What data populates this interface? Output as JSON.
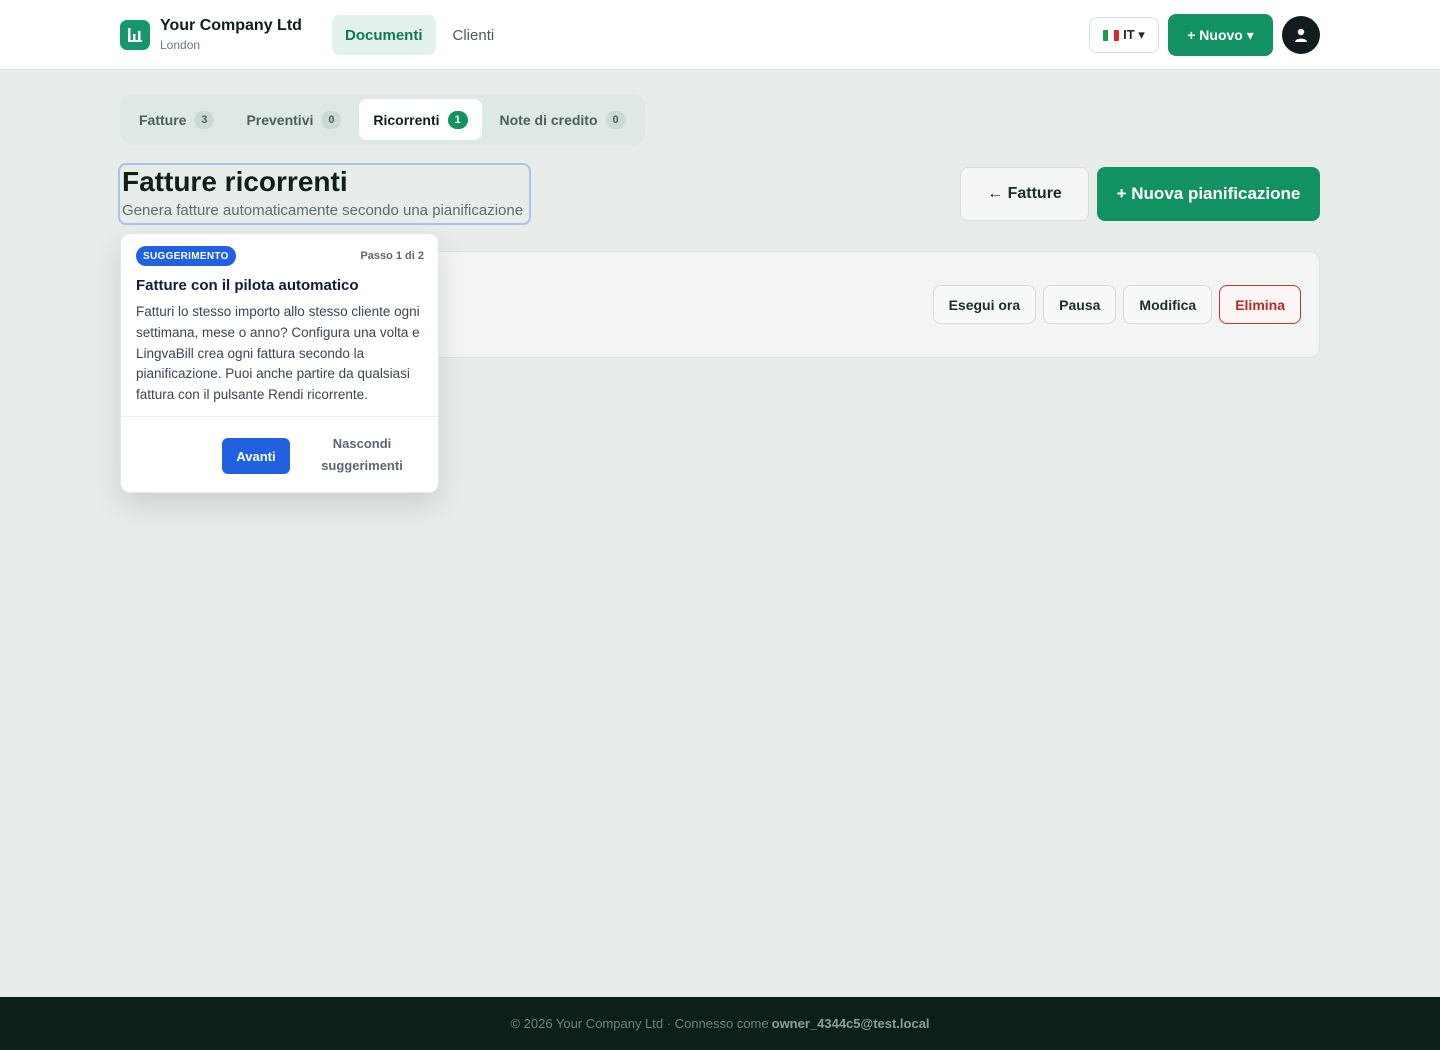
{
  "header": {
    "company_name": "Your Company Ltd",
    "company_city": "London",
    "nav": [
      {
        "label": "Documenti",
        "active": true
      },
      {
        "label": "Clienti",
        "active": false
      }
    ],
    "language": "IT ▾",
    "new_button": "+ Nuovo ▾",
    "brand_color": "#129163"
  },
  "tabs": [
    {
      "label": "Fatture",
      "count": "3",
      "active": false
    },
    {
      "label": "Preventivi",
      "count": "0",
      "active": false
    },
    {
      "label": "Ricorrenti",
      "count": "1",
      "active": true
    },
    {
      "label": "Note di credito",
      "count": "0",
      "active": false
    }
  ],
  "page": {
    "title": "Fatture ricorrenti",
    "subtitle": "Genera fatture automaticamente secondo una pianificazione",
    "back_button": "← Fatture",
    "new_schedule_button": "+ Nuova pianificazione"
  },
  "card": {
    "actions": {
      "run": "Esegui ora",
      "pause": "Pausa",
      "edit": "Modifica",
      "delete": "Elimina"
    }
  },
  "tooltip": {
    "badge": "SUGGERIMENTO",
    "step": "Passo 1 di 2",
    "title": "Fatture con il pilota automatico",
    "body": "Fatturi lo stesso importo allo stesso cliente ogni settimana, mese o anno? Configura una volta e LingvaBill crea ogni fattura secondo la pianificazione. Puoi anche partire da qualsiasi fattura con il pulsante Rendi ricorrente.",
    "next_button": "Avanti",
    "hide_button": "Nascondi suggerimenti",
    "accent_color": "#2160e0"
  },
  "footer": {
    "text": "© 2026 Your Company Ltd · Connesso come",
    "user": "owner_4344c5@test.local"
  }
}
